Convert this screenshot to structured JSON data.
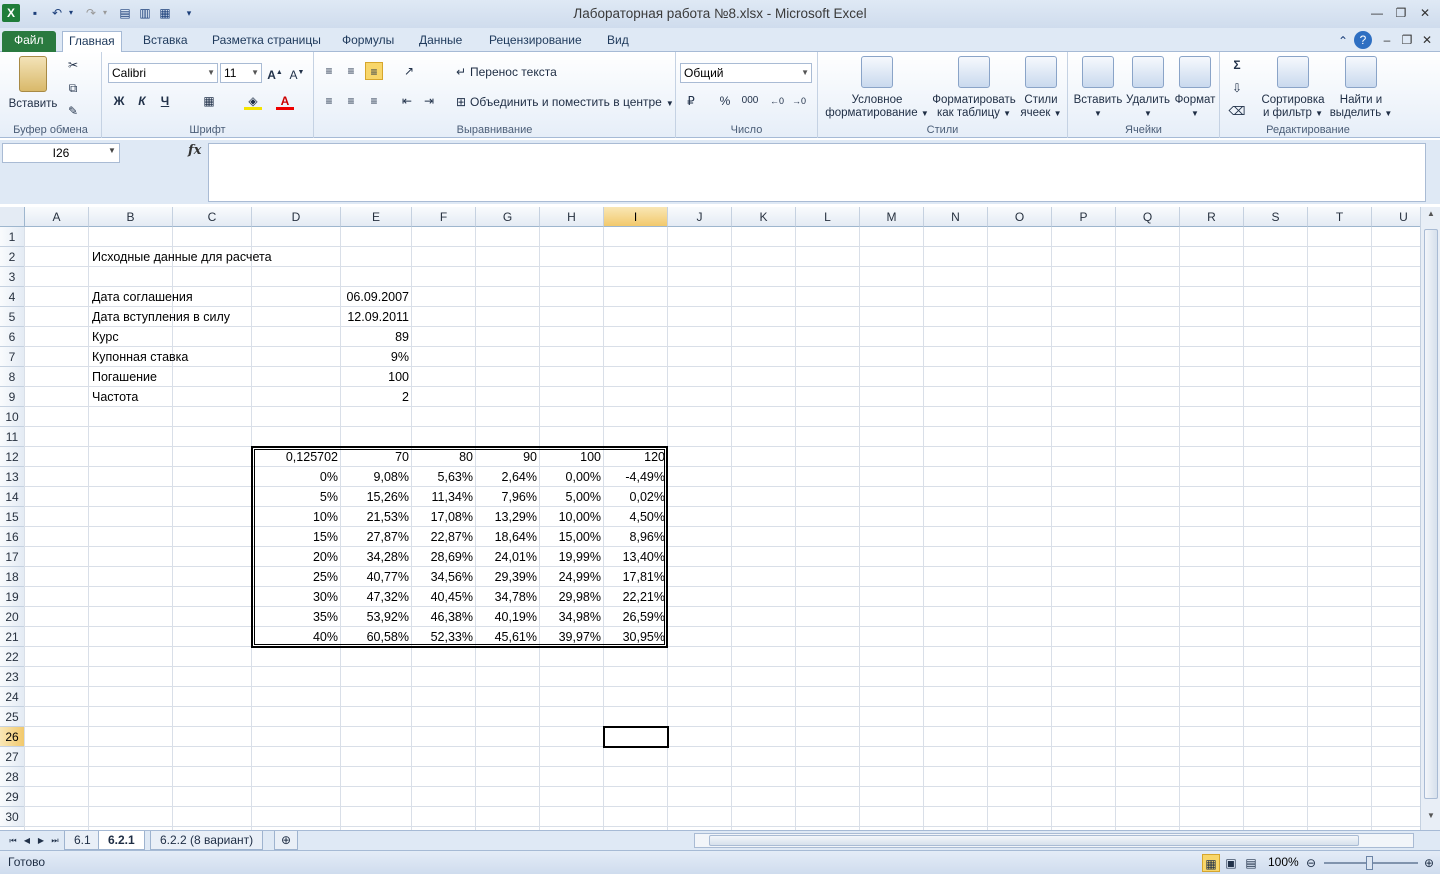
{
  "window": {
    "title": "Лабораторная работа №8.xlsx  -  Microsoft Excel"
  },
  "tabs": [
    "Файл",
    "Главная",
    "Вставка",
    "Разметка страницы",
    "Формулы",
    "Данные",
    "Рецензирование",
    "Вид"
  ],
  "ribbon": {
    "clipboard": {
      "paste": "Вставить",
      "label": "Буфер обмена"
    },
    "font": {
      "name": "Calibri",
      "size": "11",
      "label": "Шрифт",
      "bold": "Ж",
      "italic": "К",
      "underline": "Ч"
    },
    "align": {
      "wrap": "Перенос текста",
      "merge": "Объединить и поместить в центре",
      "label": "Выравнивание"
    },
    "number": {
      "format": "Общий",
      "label": "Число",
      "percent": "%",
      "thousands": "000"
    },
    "styles": {
      "cond": [
        "Условное",
        "форматирование"
      ],
      "table": [
        "Форматировать",
        "как таблицу"
      ],
      "cell": [
        "Стили",
        "ячеек"
      ],
      "label": "Стили"
    },
    "cells": {
      "insert": "Вставить",
      "delete": "Удалить",
      "format": "Формат",
      "label": "Ячейки"
    },
    "editing": {
      "sort": [
        "Сортировка",
        "и фильтр"
      ],
      "find": [
        "Найти и",
        "выделить"
      ],
      "label": "Редактирование",
      "sum": "Σ"
    }
  },
  "formula_bar": {
    "name_box": "I26",
    "fx": "fx",
    "formula": ""
  },
  "columns": [
    "A",
    "B",
    "C",
    "D",
    "E",
    "F",
    "G",
    "H",
    "I",
    "J",
    "K",
    "L",
    "M",
    "N",
    "O",
    "P",
    "Q",
    "R",
    "S",
    "T",
    "U"
  ],
  "selected_column": "I",
  "selected_row": "26",
  "rows": [
    "1",
    "2",
    "3",
    "4",
    "5",
    "6",
    "7",
    "8",
    "9",
    "10",
    "11",
    "12",
    "13",
    "14",
    "15",
    "16",
    "17",
    "18",
    "19",
    "20",
    "21",
    "22",
    "23",
    "24",
    "25",
    "26",
    "27",
    "28",
    "29",
    "30"
  ],
  "labels": {
    "title": "Исходные данные для расчета",
    "items": [
      {
        "label": "Дата соглашения",
        "value": "06.09.2007"
      },
      {
        "label": "Дата вступления в силу",
        "value": "12.09.2011"
      },
      {
        "label": "Курс",
        "value": "89"
      },
      {
        "label": "Купонная ставка",
        "value": "9%"
      },
      {
        "label": "Погашение",
        "value": "100"
      },
      {
        "label": "Частота",
        "value": "2"
      }
    ]
  },
  "table": {
    "header": [
      "0,125702",
      "70",
      "80",
      "90",
      "100",
      "120"
    ],
    "rows": [
      [
        "0%",
        "9,08%",
        "5,63%",
        "2,64%",
        "0,00%",
        "-4,49%"
      ],
      [
        "5%",
        "15,26%",
        "11,34%",
        "7,96%",
        "5,00%",
        "0,02%"
      ],
      [
        "10%",
        "21,53%",
        "17,08%",
        "13,29%",
        "10,00%",
        "4,50%"
      ],
      [
        "15%",
        "27,87%",
        "22,87%",
        "18,64%",
        "15,00%",
        "8,96%"
      ],
      [
        "20%",
        "34,28%",
        "28,69%",
        "24,01%",
        "19,99%",
        "13,40%"
      ],
      [
        "25%",
        "40,77%",
        "34,56%",
        "29,39%",
        "24,99%",
        "17,81%"
      ],
      [
        "30%",
        "47,32%",
        "40,45%",
        "34,78%",
        "29,98%",
        "22,21%"
      ],
      [
        "35%",
        "53,92%",
        "46,38%",
        "40,19%",
        "34,98%",
        "26,59%"
      ],
      [
        "40%",
        "60,58%",
        "52,33%",
        "45,61%",
        "39,97%",
        "30,95%"
      ]
    ]
  },
  "sheets": [
    "6.1",
    "6.2.1",
    "6.2.2 (8 вариант)"
  ],
  "active_sheet": "6.2.1",
  "status": {
    "ready": "Готово",
    "zoom": "100%"
  }
}
